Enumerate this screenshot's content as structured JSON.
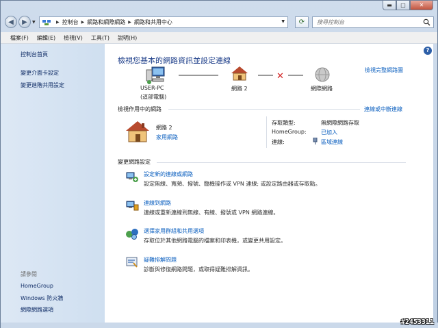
{
  "window": {
    "caption_buttons": {
      "minimize": "▬",
      "maximize": "□",
      "close": "✕"
    }
  },
  "addressbar": {
    "crumbs": [
      "控制台",
      "網路和網際網路",
      "網路和共用中心"
    ]
  },
  "search": {
    "placeholder": "搜尋控制台"
  },
  "menubar": {
    "items": [
      "檔案(F)",
      "編輯(E)",
      "檢視(V)",
      "工具(T)",
      "說明(H)"
    ]
  },
  "sidebar": {
    "top_links": [
      "控制台首頁",
      "變更介面卡設定",
      "變更進階共用設定"
    ],
    "see_also_label": "請參閱",
    "see_also_links": [
      "HomeGroup",
      "Windows 防火牆",
      "網際網路選項"
    ]
  },
  "main": {
    "title": "檢視您基本的網路資訊並設定連線",
    "full_map_link": "檢視完整網路圖",
    "map": {
      "computer_name": "USER-PC",
      "computer_sub": "(這部電腦)",
      "network_name": "網路  2",
      "internet_label": "網際網路"
    },
    "active_section_label": "檢視作用中的網路",
    "connect_disconnect_link": "連線或中斷連線",
    "active_network": {
      "name": "網路  2",
      "type": "家用網路",
      "access_type_label": "存取類型:",
      "access_type_value": "無網際網路存取",
      "homegroup_label": "HomeGroup:",
      "homegroup_value": "已加入",
      "connections_label": "連線:",
      "connections_value": "區域連線"
    },
    "settings_section_label": "變更網路設定",
    "tasks": [
      {
        "title": "設定新的連線或網路",
        "desc": "設定無線、寬頻、撥號、臨機操作或 VPN 連線; 或設定路由器或存取點。",
        "icon": "new-connection-icon"
      },
      {
        "title": "連線到網路",
        "desc": "連線或重新連線到無線、有線、撥號或 VPN 網路連線。",
        "icon": "connect-network-icon"
      },
      {
        "title": "選擇家用群組和共用選項",
        "desc": "存取位於其他網路電腦的檔案和印表機，或變更共用設定。",
        "icon": "homegroup-icon"
      },
      {
        "title": "疑難排解問題",
        "desc": "診斷與修復網路問題，或取得疑難排解資訊。",
        "icon": "troubleshoot-icon"
      }
    ]
  },
  "watermark": "#2453311"
}
